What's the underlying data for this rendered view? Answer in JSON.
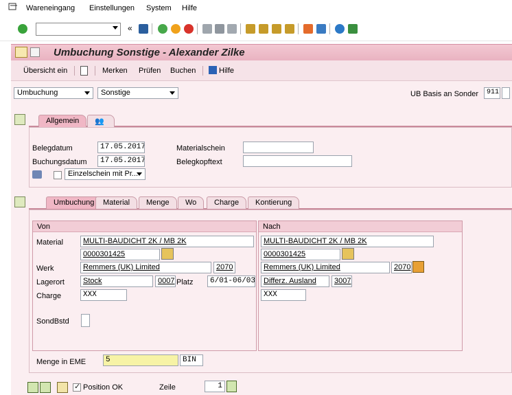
{
  "menu": {
    "items": [
      "Wareneingang",
      "Einstellungen",
      "System",
      "Hilfe"
    ]
  },
  "toolbar": {
    "command_value": "",
    "icons": [
      "enter-icon",
      "back-icon",
      "save-icon",
      "back-nav-icon",
      "exit-icon",
      "cancel-icon",
      "print-icon",
      "find-icon",
      "find-next-icon",
      "first-page-icon",
      "prev-page-icon",
      "next-page-icon",
      "last-page-icon",
      "create-session-icon",
      "shortcut-icon",
      "help-icon",
      "layout-icon"
    ]
  },
  "title": "Umbuchung Sonstige - Alexander Zilke",
  "app_toolbar": {
    "overview": "Übersicht ein",
    "remember": "Merken",
    "check": "Prüfen",
    "post": "Buchen",
    "help": "Hilfe"
  },
  "header": {
    "transaction_select": "Umbuchung",
    "reference_select": "Sonstige",
    "movement_label": "UB Basis an Sonder",
    "movement_type": "911"
  },
  "tabs_top": {
    "general": "Allgemein"
  },
  "general": {
    "doc_date_label": "Belegdatum",
    "doc_date": "17.05.2017",
    "post_date_label": "Buchungsdatum",
    "post_date": "17.05.2017",
    "material_slip_label": "Materialschein",
    "material_slip": "",
    "header_text_label": "Belegkopftext",
    "header_text": "",
    "print_option": "Einzelschein mit Pr..."
  },
  "tabs_item": {
    "transfer": "Umbuchung",
    "material": "Material",
    "quantity": "Menge",
    "where": "Wo",
    "batch": "Charge",
    "account": "Kontierung"
  },
  "from": {
    "header": "Von",
    "material_label": "Material",
    "material_text": "MULTI-BAUDICHT 2K / MB 2K",
    "material_no": "0000301425",
    "plant_label": "Werk",
    "plant_name": "Remmers (UK) Limited",
    "plant_code": "2070",
    "sloc_label": "Lagerort",
    "sloc_name": "Stock",
    "sloc_code": "0007",
    "bin_label": "Platz",
    "bin_value": "6/01-06/03",
    "batch_label": "Charge",
    "batch_value": "XXX",
    "special_stock_label": "SondBstd",
    "special_stock_value": ""
  },
  "to": {
    "header": "Nach",
    "material_text": "MULTI-BAUDICHT 2K / MB 2K",
    "material_no": "0000301425",
    "plant_name": "Remmers (UK) Limited",
    "plant_code": "2070",
    "sloc_name": "Differz. Ausland",
    "sloc_code": "3007",
    "batch_value": "XXX"
  },
  "quantity": {
    "label": "Menge in EME",
    "value": "5",
    "unit": "BIN"
  },
  "footer": {
    "position_ok_label": "Position OK",
    "line_label": "Zeile",
    "line_value": "1"
  },
  "colors": {
    "title_bg": "#f0c1cd",
    "panel_bg": "#fbeef1",
    "active_tab": "#f0b7c5",
    "required_field": "#f7f3a6"
  }
}
